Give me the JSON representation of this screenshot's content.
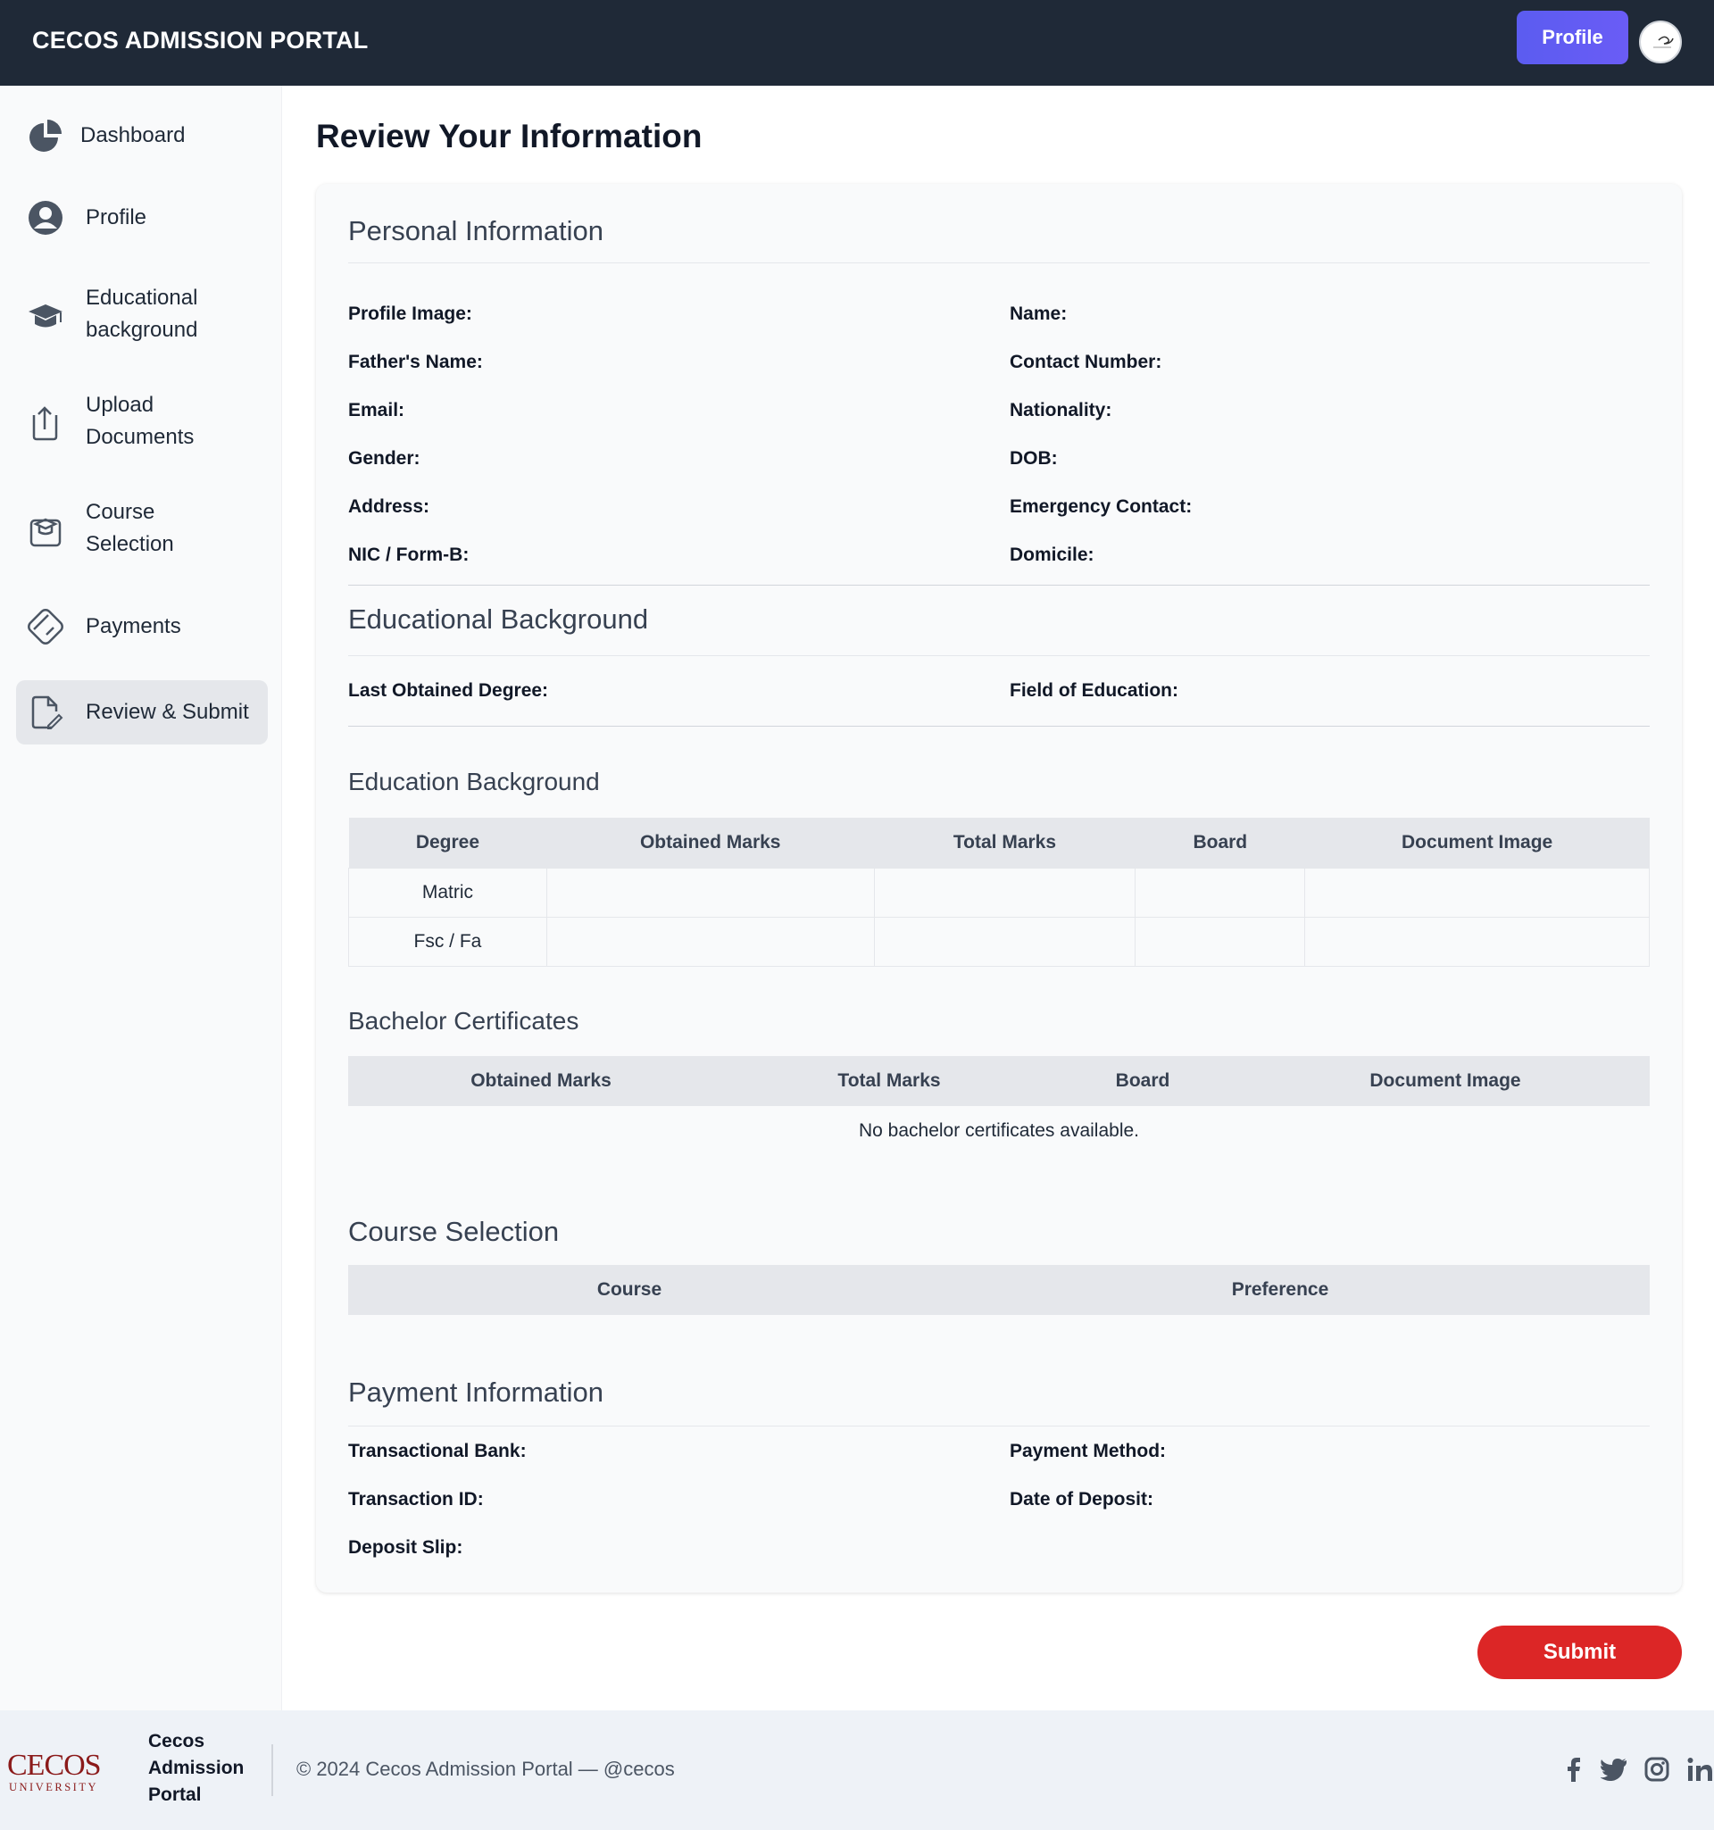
{
  "header": {
    "brand": "CECOS ADMISSION PORTAL",
    "profile_button": "Profile"
  },
  "sidebar": {
    "items": [
      {
        "line1": "Dashboard",
        "line2": "",
        "icon": "pie-chart-icon"
      },
      {
        "line1": "Profile",
        "line2": "",
        "icon": "user-circle-icon"
      },
      {
        "line1": "Educational",
        "line2": "background",
        "icon": "graduation-cap-icon"
      },
      {
        "line1": "Upload",
        "line2": "Documents",
        "icon": "upload-document-icon"
      },
      {
        "line1": "Course",
        "line2": "Selection",
        "icon": "course-icon"
      },
      {
        "line1": "Payments",
        "line2": "",
        "icon": "credit-card-icon"
      },
      {
        "line1": "Review & Submit",
        "line2": "",
        "icon": "edit-document-icon",
        "active": true
      }
    ]
  },
  "main": {
    "title": "Review Your Information",
    "personal": {
      "title": "Personal Information",
      "fields": {
        "profile_image": "Profile Image:",
        "name": "Name:",
        "father_name": "Father's Name:",
        "contact": "Contact Number:",
        "email": "Email:",
        "nationality": "Nationality:",
        "gender": "Gender:",
        "dob": "DOB:",
        "address": "Address:",
        "emergency": "Emergency Contact:",
        "nic": "NIC / Form-B:",
        "domicile": "Domicile:"
      }
    },
    "educational": {
      "title": "Educational Background",
      "fields": {
        "last_degree": "Last Obtained Degree:",
        "field": "Field of Education:"
      }
    },
    "education_table": {
      "title": "Education Background",
      "headers": [
        "Degree",
        "Obtained Marks",
        "Total Marks",
        "Board",
        "Document Image"
      ],
      "rows": [
        [
          "Matric",
          "",
          "",
          "",
          ""
        ],
        [
          "Fsc / Fa",
          "",
          "",
          "",
          ""
        ]
      ]
    },
    "bachelor": {
      "title": "Bachelor Certificates",
      "headers": [
        "Obtained Marks",
        "Total Marks",
        "Board",
        "Document Image"
      ],
      "empty": "No bachelor certificates available."
    },
    "course": {
      "title": "Course Selection",
      "headers": [
        "Course",
        "Preference"
      ]
    },
    "payment": {
      "title": "Payment Information",
      "fields": {
        "bank": "Transactional Bank:",
        "method": "Payment Method:",
        "txn": "Transaction ID:",
        "date": "Date of Deposit:",
        "slip": "Deposit Slip:"
      }
    },
    "submit": "Submit"
  },
  "footer": {
    "logo_text": "CECOS",
    "logo_sub": "UNIVERSITY",
    "brand_lines": [
      "Cecos",
      "Admission",
      "Portal"
    ],
    "copyright": "© 2024 Cecos Admission Portal — @cecos"
  },
  "colors": {
    "header_bg": "#1f2937",
    "accent": "#5b5cf0",
    "submit": "#dc2626",
    "logo": "#8b1a1a"
  }
}
